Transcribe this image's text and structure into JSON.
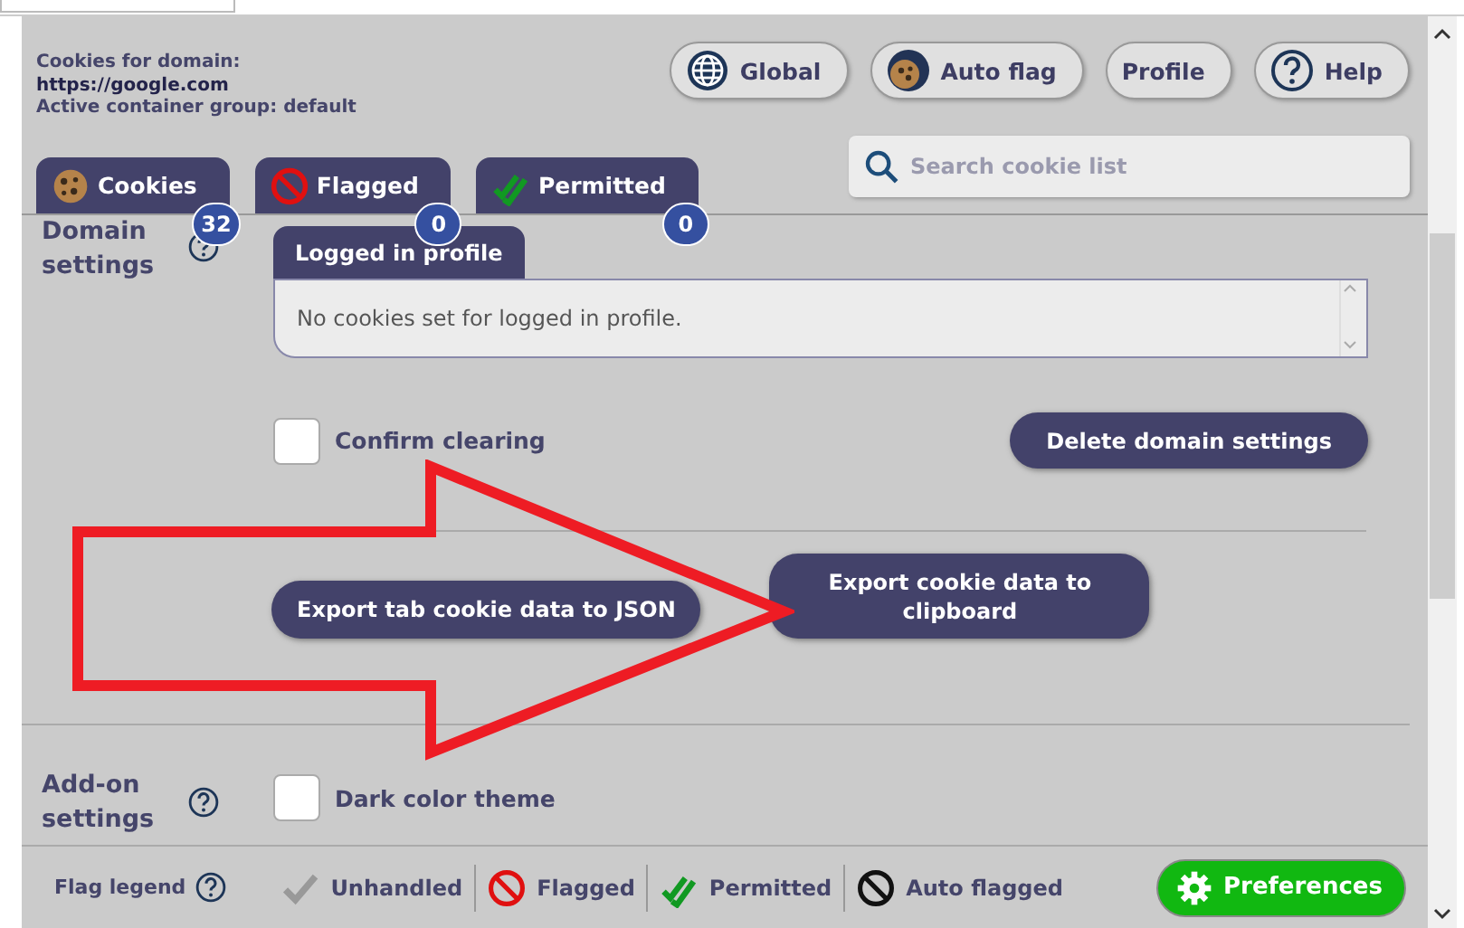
{
  "header": {
    "label": "Cookies for domain:",
    "domain": "https://google.com",
    "container": "Active container group: default"
  },
  "top_buttons": [
    {
      "label": "Global",
      "kind": "global"
    },
    {
      "label": "Auto flag",
      "kind": "autoflag"
    },
    {
      "label": "Profile",
      "kind": "profile"
    },
    {
      "label": "Help",
      "kind": "help"
    }
  ],
  "search": {
    "placeholder": "Search cookie list"
  },
  "tabs": [
    {
      "label": "Cookies",
      "kind": "cookies",
      "count": "32",
      "selected": false
    },
    {
      "label": "Flagged",
      "kind": "flagged",
      "count": "0",
      "selected": false
    },
    {
      "label": "Permitted",
      "kind": "permitted",
      "count": "0",
      "selected": false
    }
  ],
  "domain_settings": {
    "title": "Domain settings",
    "profile_tab": "Logged in profile",
    "profile_text": "No cookies set for logged in profile.",
    "confirm_clearing": {
      "label": "Confirm clearing",
      "checked": false
    },
    "delete_button": "Delete domain settings",
    "export_buttons": [
      "Export tab cookie data to JSON",
      "Export cookie data to clipboard"
    ]
  },
  "addon_settings": {
    "title": "Add-on settings",
    "dark_theme": {
      "label": "Dark color theme",
      "checked": false
    }
  },
  "footer": {
    "legend_label": "Flag legend",
    "legend": [
      {
        "label": "Unhandled",
        "kind": "unhandled"
      },
      {
        "label": "Flagged",
        "kind": "flagged"
      },
      {
        "label": "Permitted",
        "kind": "permitted"
      },
      {
        "label": "Auto flagged",
        "kind": "auto"
      }
    ],
    "preferences": "Preferences"
  }
}
